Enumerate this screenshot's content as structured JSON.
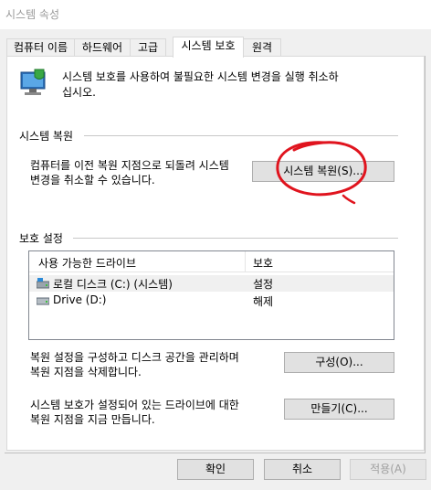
{
  "window": {
    "title": "시스템 속성"
  },
  "tabs": [
    {
      "label": "컴퓨터 이름"
    },
    {
      "label": "하드웨어"
    },
    {
      "label": "고급"
    },
    {
      "label": "시스템 보호"
    },
    {
      "label": "원격"
    }
  ],
  "intro": {
    "line1": "시스템 보호를 사용하여 불필요한 시스템 변경을 실행 취소하",
    "line2": "십시오."
  },
  "system_restore": {
    "title": "시스템 복원",
    "desc_line1": "컴퓨터를 이전 복원 지점으로 되돌려 시스템",
    "desc_line2": "변경을 취소할 수 있습니다.",
    "button": "시스템 복원(S)..."
  },
  "protection": {
    "title": "보호 설정",
    "columns": {
      "drive": "사용 가능한 드라이브",
      "protection": "보호"
    },
    "drives": [
      {
        "name": "로컬 디스크 (C:) (시스템)",
        "status": "설정"
      },
      {
        "name": "Drive (D:)",
        "status": "해제"
      }
    ],
    "configure_text_line1": "복원 설정을 구성하고 디스크 공간을 관리하며",
    "configure_text_line2": "복원 지점을 삭제합니다.",
    "configure_button": "구성(O)...",
    "create_text_line1": "시스템 보호가 설정되어 있는 드라이브에 대한",
    "create_text_line2": "복원 지점을 지금 만듭니다.",
    "create_button": "만들기(C)..."
  },
  "footer": {
    "ok": "확인",
    "cancel": "취소",
    "apply": "적용(A)"
  },
  "icons": {
    "system_protection": "computer-shield-icon",
    "system_drive": "system-drive-icon",
    "drive": "drive-icon"
  },
  "colors": {
    "annotation_circle": "#e0141e",
    "tab_active_bg": "#ffffff",
    "dialog_bg": "#f0f0f0"
  }
}
